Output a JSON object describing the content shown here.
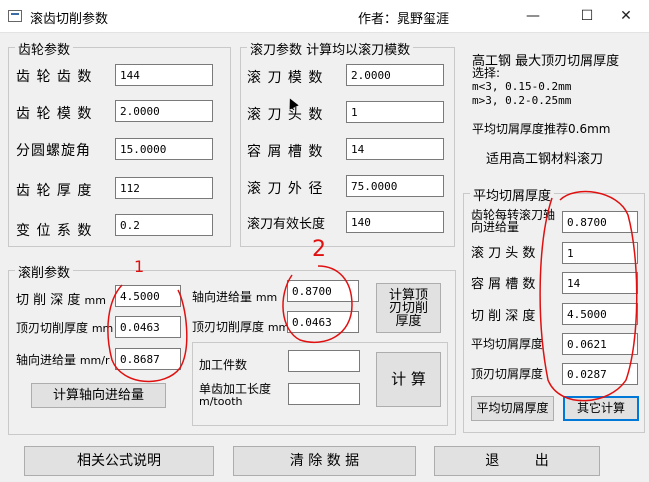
{
  "window": {
    "title": "滚齿切削参数",
    "author": "作者：晁野玺涯"
  },
  "gear_params": {
    "title": "齿轮参数",
    "rows": [
      {
        "label": "齿 轮 齿 数",
        "value": "144"
      },
      {
        "label": "齿 轮 模 数",
        "value": "2.0000"
      },
      {
        "label": "分圆螺旋角",
        "value": "15.0000"
      },
      {
        "label": "齿 轮 厚 度",
        "value": "112"
      },
      {
        "label": "变 位 系 数",
        "value": "0.2"
      }
    ]
  },
  "hob_params": {
    "title": "滚刀参数  计算均以滚刀模数",
    "rows": [
      {
        "label": "滚 刀 模 数",
        "value": "2.0000"
      },
      {
        "label": "滚 刀 头 数",
        "value": "1"
      },
      {
        "label": "容 屑 槽 数",
        "value": "14"
      },
      {
        "label": "滚 刀 外 径",
        "value": "75.0000"
      },
      {
        "label": "滚刀有效长度",
        "value": "140"
      }
    ]
  },
  "info": {
    "title": "高工钢 最大顶刃切屑厚度",
    "select": "选择:",
    "line1": "m<3,  0.15-0.2mm",
    "line2": "m>3,  0.2-0.25mm",
    "recommend": "平均切屑厚度推荐0.6mm",
    "material": "适用高工钢材料滚刀"
  },
  "hobbing": {
    "title": "滚削参数",
    "cut_depth_label": "切 削 深 度",
    "cut_depth_unit": "mm",
    "cut_depth": "4.5000",
    "top_chip_label": "顶刃切削厚度",
    "top_chip_unit": "mm",
    "top_chip": "0.0463",
    "axial_feed_label": "轴向进给量",
    "axial_feed_unit": "mm/r",
    "axial_feed": "0.8687",
    "feed_label": "轴向进给量",
    "feed_unit": "mm",
    "feed_value": "0.8700",
    "top_chip2_label": "顶刃切削厚度",
    "top_chip2_unit": "mm",
    "top_chip2_value": "0.0463",
    "calc_top_button": "计算顶刃切削厚度",
    "calc_feed_button": "计算轴向进给量",
    "workpiece_label": "加工件数",
    "workpiece_value": "",
    "single_time_label": "单齿加工长度",
    "single_time_unit": "m/tooth",
    "single_time_value": "",
    "calc_button": "计 算"
  },
  "avg_chip": {
    "title": "平均切屑厚度",
    "rows": [
      {
        "label": "齿轮每转滚刀轴向进给量",
        "value": "0.8700"
      },
      {
        "label": "滚 刀 头 数",
        "value": "1"
      },
      {
        "label": "容 屑 槽 数",
        "value": "14"
      },
      {
        "label": "切 削 深 度",
        "value": "4.5000"
      },
      {
        "label": "平均切屑厚度",
        "value": "0.0621"
      },
      {
        "label": "顶刃切屑厚度",
        "value": "0.0287"
      }
    ],
    "avg_button": "平均切屑厚度",
    "other_button": "其它计算"
  },
  "bottom": {
    "formula_button": "相关公式说明",
    "clear_button": "清 除 数 据",
    "exit_button": "退        出"
  },
  "annotations": {
    "mark1": "1",
    "mark2": "2"
  }
}
